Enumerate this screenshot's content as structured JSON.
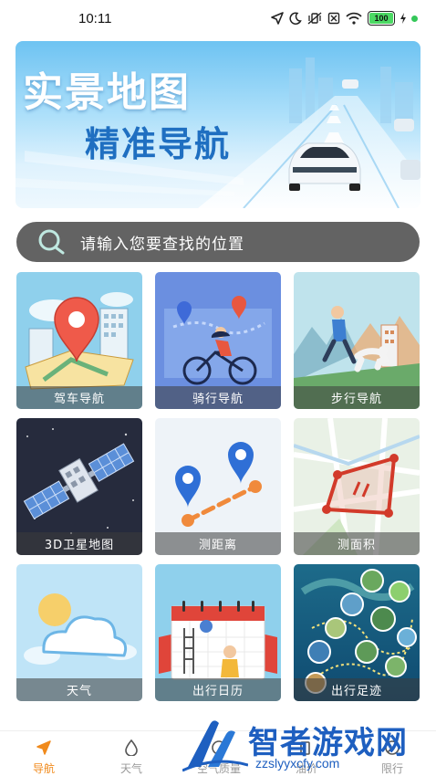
{
  "status_bar": {
    "time": "10:11",
    "battery": "100"
  },
  "banner": {
    "line1": "实景地图",
    "line2": "精准导航"
  },
  "search": {
    "placeholder": "请输入您要查找的位置"
  },
  "tiles": [
    {
      "label": "驾车导航",
      "icon": "map-pin-city-icon"
    },
    {
      "label": "骑行导航",
      "icon": "cyclist-icon"
    },
    {
      "label": "步行导航",
      "icon": "runner-dog-icon"
    },
    {
      "label": "3D卫星地图",
      "icon": "satellite-icon"
    },
    {
      "label": "测距离",
      "icon": "distance-pins-icon"
    },
    {
      "label": "测面积",
      "icon": "area-polygon-icon"
    },
    {
      "label": "天气",
      "icon": "cloud-icon"
    },
    {
      "label": "出行日历",
      "icon": "calendar-icon"
    },
    {
      "label": "出行足迹",
      "icon": "footprint-map-icon"
    }
  ],
  "bottom_nav": [
    {
      "label": "导航",
      "active": true
    },
    {
      "label": "天气",
      "active": false
    },
    {
      "label": "空气质量",
      "active": false
    },
    {
      "label": "油价",
      "active": false
    },
    {
      "label": "限行",
      "active": false
    }
  ],
  "watermark": {
    "title": "智者游戏网",
    "url": "zzslyyxcfy.com"
  },
  "colors": {
    "accent": "#f08a1c",
    "search_bg": "#636363",
    "nav_inactive": "#999999"
  }
}
